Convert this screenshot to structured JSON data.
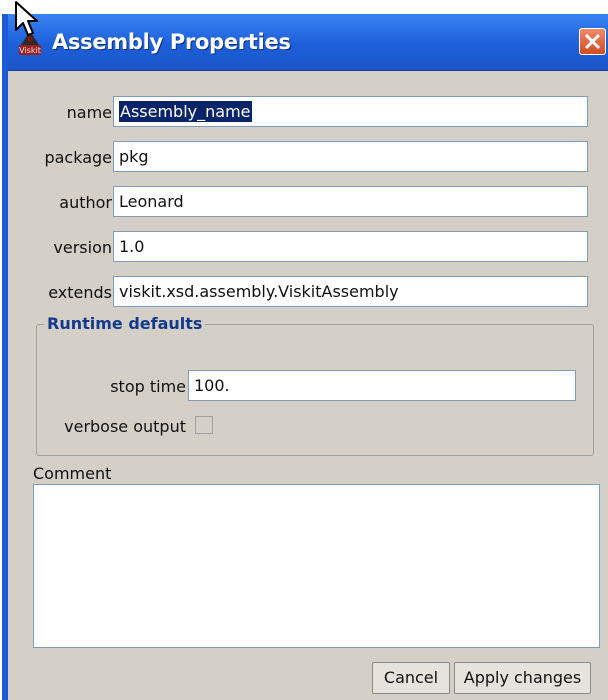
{
  "window": {
    "title": "Assembly Properties"
  },
  "form": {
    "name": {
      "label": "name",
      "value": "Assembly_name"
    },
    "package": {
      "label": "package",
      "value": "pkg"
    },
    "author": {
      "label": "author",
      "value": "Leonard"
    },
    "version": {
      "label": "version",
      "value": "1.0"
    },
    "extends": {
      "label": "extends",
      "value": "viskit.xsd.assembly.ViskitAssembly"
    }
  },
  "runtime": {
    "title": "Runtime defaults",
    "stop_time": {
      "label": "stop time",
      "value": "100."
    },
    "verbose_output": {
      "label": "verbose output",
      "checked": false
    }
  },
  "comment": {
    "label": "Comment",
    "value": ""
  },
  "buttons": {
    "cancel": "Cancel",
    "apply": "Apply changes"
  },
  "colors": {
    "titlebar": "#1d5fd9",
    "window_bg": "#d4d0c8",
    "group_title": "#143a8c",
    "selection": "#0a246a"
  }
}
